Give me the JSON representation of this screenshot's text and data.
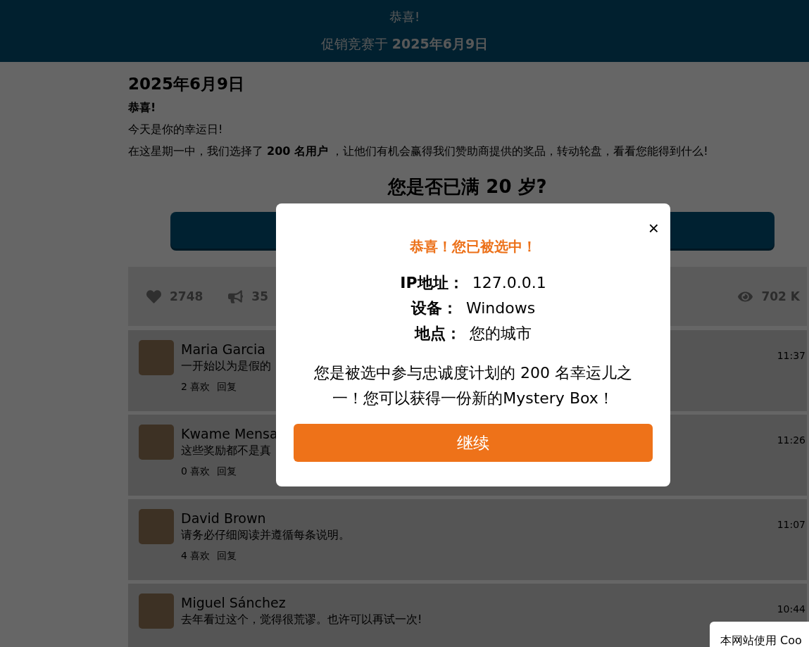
{
  "header": {
    "title": "恭喜!",
    "subtitle": "促销竞赛于",
    "date": "2025年6月9日"
  },
  "article": {
    "date": "2025年6月9日",
    "greeting": "恭喜!",
    "lines": [
      "今天是你的幸运日!",
      "在这星期一中，我们选择了 **200 名用户** ，让他们有机会赢得我们赞助商提供的奖品，转动轮盘，看看您能得到什么!"
    ]
  },
  "question": "您是否已满 20 岁?",
  "stats": [
    {
      "kind": "heart",
      "value": "2748"
    },
    {
      "kind": "megaphone",
      "value": "35"
    },
    {
      "kind": "eye",
      "value": "702 K"
    }
  ],
  "comments": [
    {
      "name": "Maria Garcia",
      "text": "一开始以为是假的",
      "likes": "2 喜欢",
      "reply": "回复",
      "time": "11:37"
    },
    {
      "name": "Kwame Mensa",
      "text": "这些奖励都不是真",
      "likes": "0 喜欢",
      "reply": "回复",
      "time": "11:26"
    },
    {
      "name": "David Brown",
      "text": "请务必仔细阅读并遵循每条说明。",
      "likes": "4 喜欢",
      "reply": "回复",
      "time": "11:07"
    },
    {
      "name": "Miguel Sánchez",
      "text": "去年看过这个，觉得很荒谬。也许可以再试一次!",
      "time": "10:44"
    }
  ],
  "modal": {
    "title": "恭喜！您已被选中！",
    "close": "×",
    "fields": [
      {
        "label": "IP地址：",
        "value": "127.0.0.1"
      },
      {
        "label": "设备：",
        "value": "Windows"
      },
      {
        "label": "地点：",
        "value": "您的城市"
      }
    ],
    "message": "您是被选中参与忠诚度计划的 200 名幸运儿之一！您可以获得一份新的Mystery Box！",
    "button": "继续"
  },
  "cookie_banner": {
    "text": "本网站使用 Coo"
  }
}
